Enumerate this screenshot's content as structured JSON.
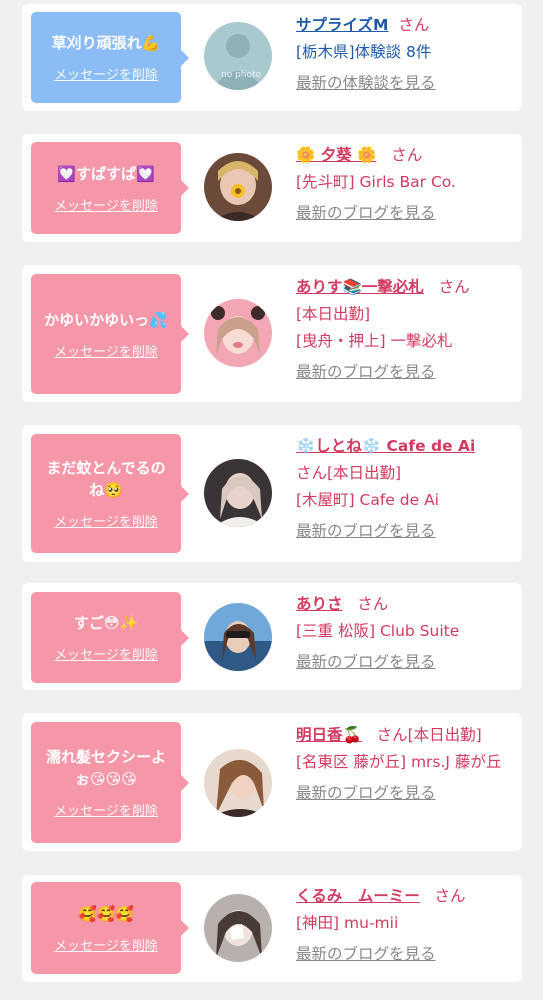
{
  "items": [
    {
      "message": "草刈り頑張れ💪",
      "delete_label": "メッセージを削除",
      "name": "サプライズM",
      "honorific": "さん",
      "lines": [
        "[栃木県]体験談 8件"
      ],
      "link": "最新の体験談を見る",
      "theme": "blue",
      "avatar_text": "no photo"
    },
    {
      "message": "💟すぱすぱ💟",
      "delete_label": "メッセージを削除",
      "name": "🌼 夕葵 🌼",
      "honorific": "さん",
      "lines": [
        "[先斗町] Girls Bar Co."
      ],
      "link": "最新のブログを見る",
      "theme": "pink"
    },
    {
      "message": "かゆいかゆいっ💦",
      "delete_label": "メッセージを削除",
      "name": "ありす📚一撃必札",
      "honorific": "さん",
      "lines": [
        "[本日出勤]",
        "[曳舟・押上] 一撃必札"
      ],
      "link": "最新のブログを見る",
      "theme": "pink"
    },
    {
      "message": "まだ蚊とんでるのね🥺",
      "delete_label": "メッセージを削除",
      "name": "❄️しとね❄️ Cafe de Ai",
      "honorific": "さん[本日出勤]",
      "lines": [
        "[木屋町] Cafe de Ai"
      ],
      "link": "最新のブログを見る",
      "theme": "pink"
    },
    {
      "message": "すご😳✨",
      "delete_label": "メッセージを削除",
      "name": "ありさ",
      "honorific": "さん",
      "lines": [
        "[三重 松阪] Club Suite"
      ],
      "link": "最新のブログを見る",
      "theme": "pink"
    },
    {
      "message": "濡れ髪セクシーよぉ😘😘😘",
      "delete_label": "メッセージを削除",
      "name": "明日香🍒",
      "honorific": "さん[本日出勤]",
      "lines": [
        "[名東区 藤が丘] mrs.J 藤が丘"
      ],
      "link": "最新のブログを見る",
      "theme": "pink"
    },
    {
      "message": "🥰🥰🥰",
      "delete_label": "メッセージを削除",
      "name": "くるみ　ムーミー",
      "honorific": "さん",
      "lines": [
        "[神田] mu-mii"
      ],
      "link": "最新のブログを見る",
      "theme": "pink"
    }
  ],
  "colors": {
    "blue_bubble": "#8cbcf5",
    "pink_bubble": "#f697a9",
    "blue_text": "#1e5aa8",
    "pink_text": "#d23b5f",
    "link_gray": "#888888"
  }
}
